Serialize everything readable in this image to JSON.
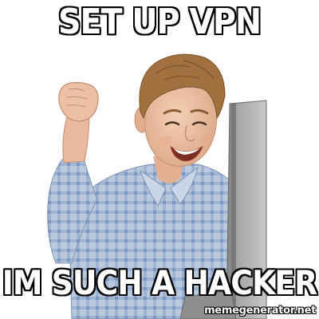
{
  "meme": {
    "top_text": "SET UP VPN",
    "bottom_text": "IM SUCH A HACKER",
    "watermark": "memegenerator.net"
  },
  "colors": {
    "caption_fill": "#ffffff",
    "caption_outline": "#000000",
    "background": "#ffffff",
    "shirt": "#9fb4d0",
    "hair": "#a0703e",
    "skin": "#ecc2a6",
    "laptop": "#9a9a9a"
  }
}
